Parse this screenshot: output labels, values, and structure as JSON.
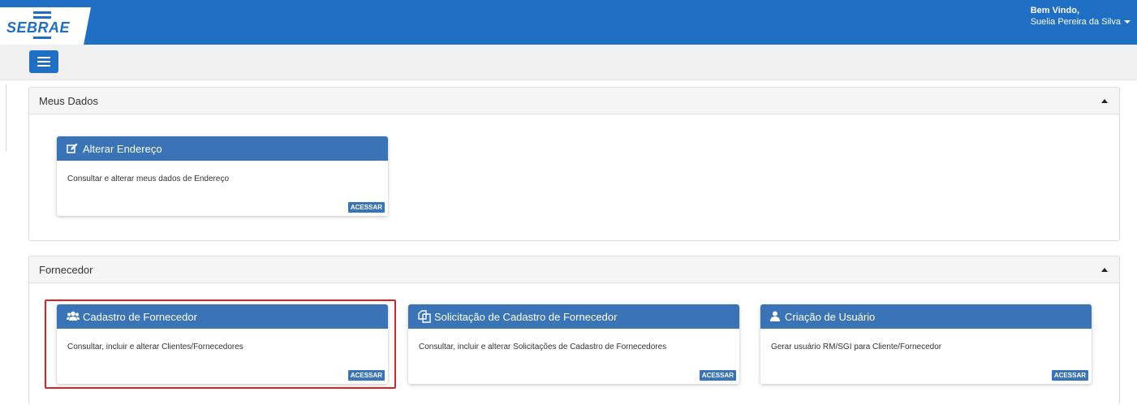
{
  "header": {
    "logo_text": "SEBRAE",
    "welcome_label": "Bem Vindo,",
    "user_name": "Suelia Pereira da Silva"
  },
  "menu": {
    "icon": "hamburger-icon"
  },
  "sections": [
    {
      "title": "Meus Dados",
      "cards": [
        {
          "icon": "edit-icon",
          "title": "Alterar Endereço",
          "description": "Consultar e alterar meus dados de Endereço",
          "action": "ACESSAR"
        }
      ]
    },
    {
      "title": "Fornecedor",
      "cards": [
        {
          "icon": "users-icon",
          "title": "Cadastro de Fornecedor",
          "description": "Consultar, incluir e alterar Clientes/Fornecedores",
          "action": "ACESSAR"
        },
        {
          "icon": "copy-icon",
          "title": "Solicitação de Cadastro de Fornecedor",
          "description": "Consultar, incluir e alterar Solicitações de Cadastro de Fornecedores",
          "action": "ACESSAR"
        },
        {
          "icon": "user-icon",
          "title": "Criação de Usuário",
          "description": "Gerar usuário RM/SGI para Cliente/Fornecedor",
          "action": "ACESSAR"
        }
      ]
    }
  ],
  "colors": {
    "brand": "#1f6fc5",
    "card_header": "#3a74b6",
    "highlight": "#e02020"
  }
}
